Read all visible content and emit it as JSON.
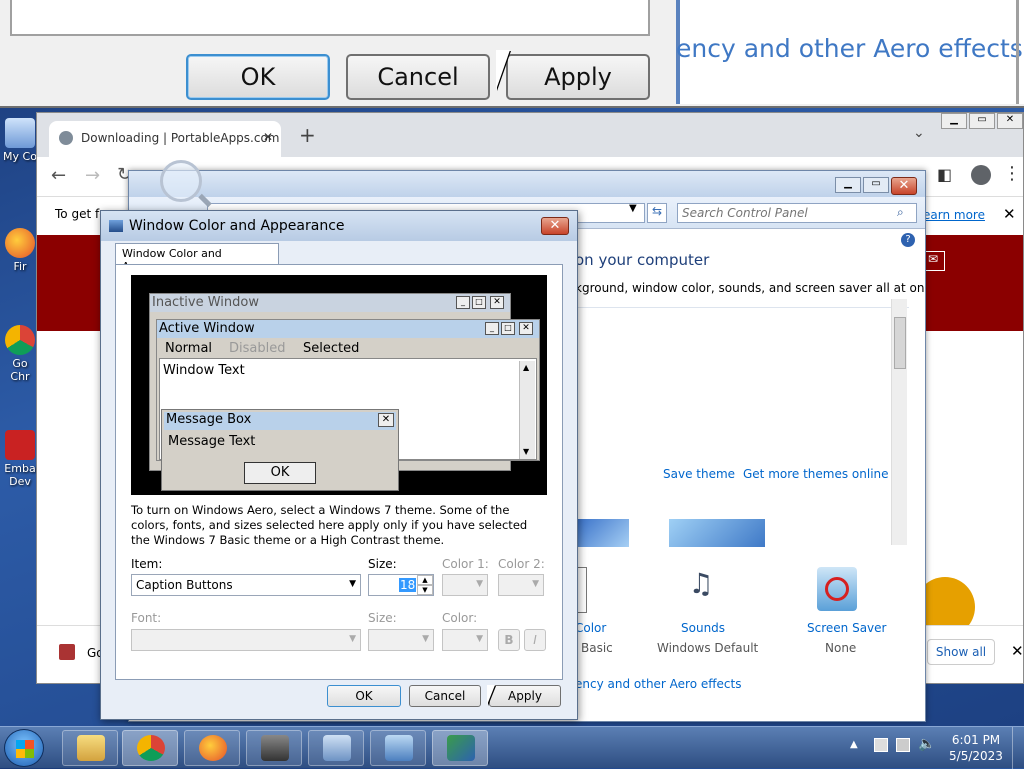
{
  "zoom": {
    "ok_label": "OK",
    "cancel_label": "Cancel",
    "apply_label": "Apply",
    "aero_text": "ency and other Aero effects"
  },
  "desktop": {
    "icons": [
      {
        "label": "My Co"
      },
      {
        "label": "Fir"
      },
      {
        "label": "Go Chr"
      },
      {
        "label": "Emba Dev"
      }
    ]
  },
  "chrome": {
    "tab_title": "Downloading | PortableApps.com",
    "new_tab": "+",
    "info_text": "To get fo",
    "learn_more": "earn more",
    "download_bar_text": "Go",
    "show_all": "Show all"
  },
  "control_panel": {
    "search_placeholder": "Search Control Panel",
    "heading": "on your computer",
    "subheading": "kground, window color, sounds, and screen saver all at once.",
    "save_theme": "Save theme",
    "get_more": "Get more themes online",
    "color_label": "Color",
    "color_sub": "Basic",
    "sounds_label": "Sounds",
    "sounds_sub": "Windows Default",
    "saver_label": "Screen Saver",
    "saver_sub": "None",
    "aero_link": "ency and other Aero effects"
  },
  "dialog": {
    "title": "Window Color and Appearance",
    "tab": "Window Color and Appearance",
    "preview": {
      "inactive": "Inactive Window",
      "active": "Active Window",
      "normal": "Normal",
      "disabled": "Disabled",
      "selected": "Selected",
      "window_text": "Window Text",
      "msg_title": "Message Box",
      "msg_text": "Message Text",
      "msg_ok": "OK"
    },
    "info": "To turn on Windows Aero, select a Windows 7 theme.  Some of the colors, fonts, and sizes selected here apply only if you have selected the Windows 7 Basic theme or a High Contrast theme.",
    "item_label": "Item:",
    "item_value": "Caption Buttons",
    "size_label": "Size:",
    "size_value": "18",
    "color1_label": "Color 1:",
    "color2_label": "Color 2:",
    "font_label": "Font:",
    "size2_label": "Size:",
    "color_label": "Color:",
    "bold": "B",
    "italic": "I",
    "ok": "OK",
    "cancel": "Cancel",
    "apply": "Apply"
  },
  "taskbar": {
    "time": "6:01 PM",
    "date": "5/5/2023"
  },
  "colors": {
    "link": "#0066cc",
    "inactive_title": "#c9d3e0",
    "active_title": "#b9d1ea",
    "chrome_band": "#8b0000"
  }
}
